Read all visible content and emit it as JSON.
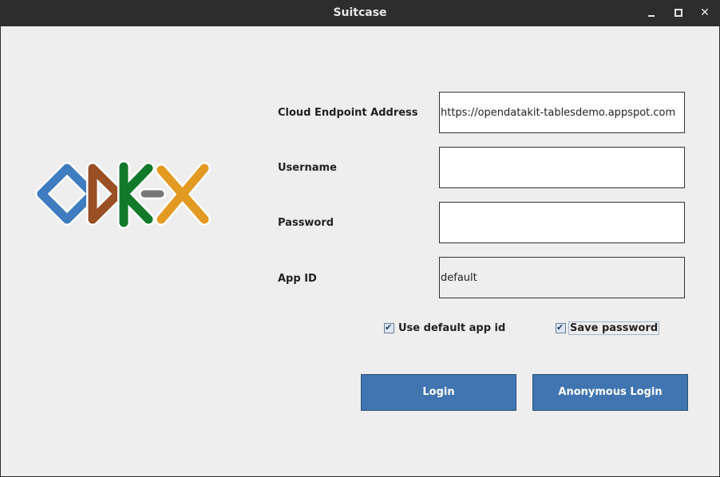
{
  "window": {
    "title": "Suitcase",
    "controls": {
      "minimize_icon": "minimize-icon",
      "maximize_icon": "maximize-icon",
      "close_icon": "close-icon",
      "close_glyph": "✕"
    }
  },
  "logo": {
    "icon": "odk-x-logo",
    "colors": {
      "o": "#3f7dc0",
      "d": "#9a4f25",
      "k": "#117a2a",
      "x": "#e39a22",
      "dash": "#777777"
    }
  },
  "form": {
    "cloud_endpoint": {
      "label": "Cloud Endpoint Address",
      "value": "https://opendatakit-tablesdemo.appspot.com"
    },
    "username": {
      "label": "Username",
      "value": ""
    },
    "password": {
      "label": "Password",
      "value": ""
    },
    "app_id": {
      "label": "App ID",
      "value": "default"
    }
  },
  "options": {
    "use_default_app_id": {
      "label": "Use default app id",
      "checked": true
    },
    "save_password": {
      "label": "Save password",
      "checked": true
    }
  },
  "buttons": {
    "login": {
      "label": "Login"
    },
    "anonymous_login": {
      "label": "Anonymous Login"
    }
  },
  "colors": {
    "button": "#4075b1",
    "titlebar": "#2d2d2d",
    "background": "#eeeeee"
  }
}
